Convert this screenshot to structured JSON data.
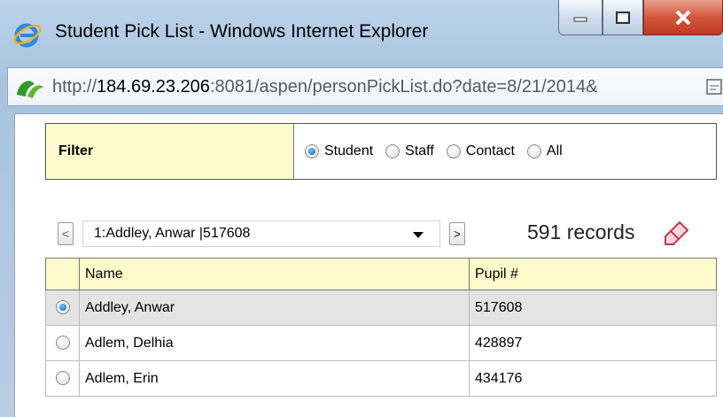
{
  "window": {
    "title": "Student Pick List - Windows Internet Explorer",
    "url_prefix": "http://",
    "url_host": "184.69.23.206",
    "url_rest": ":8081/aspen/personPickList.do?date=8/21/2014&"
  },
  "filter": {
    "label": "Filter",
    "options": [
      {
        "label": "Student",
        "selected": true
      },
      {
        "label": "Staff",
        "selected": false
      },
      {
        "label": "Contact",
        "selected": false
      },
      {
        "label": "All",
        "selected": false
      }
    ]
  },
  "nav": {
    "prev_label": "<",
    "next_label": ">",
    "selected": "1:Addley, Anwar |517608",
    "records": "591 records"
  },
  "table": {
    "columns": [
      "Name",
      "Pupil #"
    ],
    "rows": [
      {
        "name": "Addley, Anwar",
        "pupil": "517608",
        "selected": true
      },
      {
        "name": "Adlem, Delhia",
        "pupil": "428897",
        "selected": false
      },
      {
        "name": "Adlem, Erin",
        "pupil": "434176",
        "selected": false
      }
    ]
  },
  "colors": {
    "header_bg": "#fffbcc",
    "selected_row_bg": "#e4e4e4",
    "accent": "#1464b4"
  }
}
